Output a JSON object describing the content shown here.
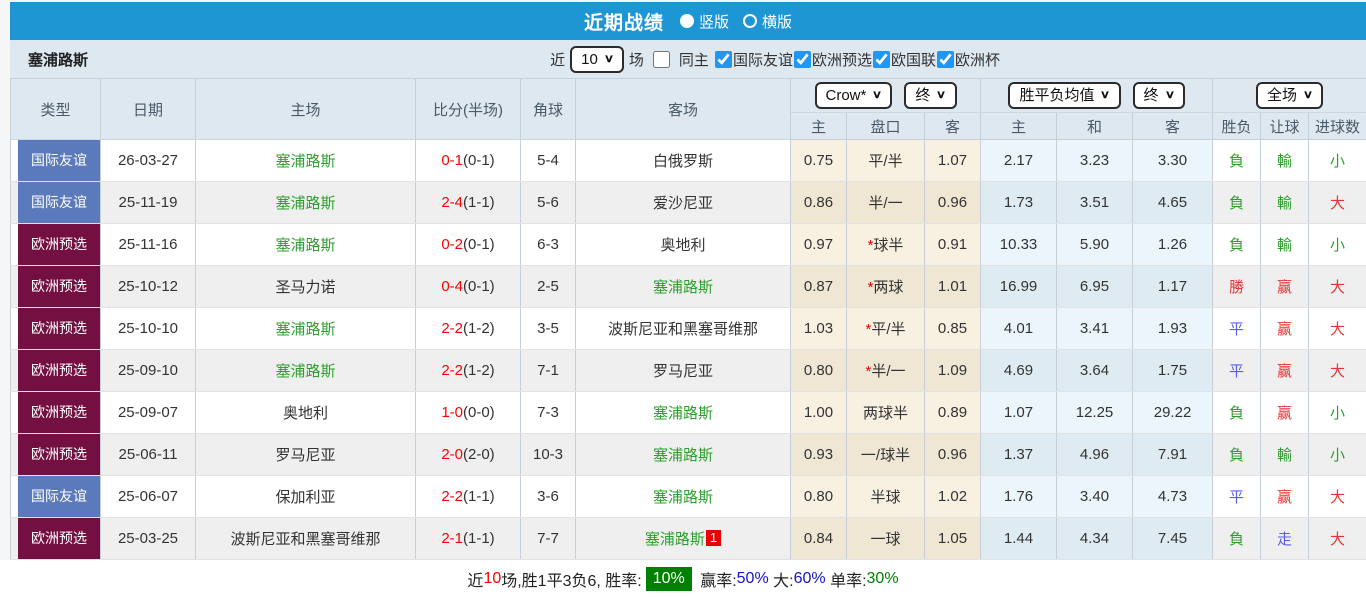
{
  "icons": {
    "chevron": "∨",
    "star": "*"
  },
  "colors": {
    "topbar_blue": "#1f96d4",
    "badge_friendly_blue": "#5b7abc",
    "badge_qualifier_maroon": "#730f41",
    "focus_team_green": "#2e9e2e",
    "score_red": "#ff0000",
    "result_green": "#2e9e2e",
    "result_red": "#e63434",
    "result_blue": "#5c5cf0"
  },
  "title_bar": {
    "title": "近期战绩",
    "radios": [
      {
        "label": "竖版",
        "selected": true
      },
      {
        "label": "横版",
        "selected": false
      }
    ]
  },
  "filter_bar": {
    "team": "塞浦路斯",
    "near_label": "近",
    "count_value": "10",
    "games_label": "场",
    "same_home": {
      "label": "同主",
      "checked": false
    },
    "leagues": [
      {
        "label": "国际友谊",
        "checked": true
      },
      {
        "label": "欧洲预选",
        "checked": true
      },
      {
        "label": "欧国联",
        "checked": true
      },
      {
        "label": "欧洲杯",
        "checked": true
      }
    ]
  },
  "table": {
    "main_headers": [
      "类型",
      "日期",
      "主场",
      "比分(半场)",
      "角球",
      "客场"
    ],
    "sub_headers": [
      "主",
      "盘口",
      "客",
      "主",
      "和",
      "客",
      "胜负",
      "让球",
      "进球数"
    ],
    "select_groups": {
      "bookmaker": {
        "label": "Crow*"
      },
      "bookmaker_time": {
        "label": "终"
      },
      "odds_type": {
        "label": "胜平负均值"
      },
      "odds_time": {
        "label": "终"
      },
      "scope": {
        "label": "全场"
      }
    },
    "rows": [
      {
        "type": "国际友谊",
        "type_color": "#5b7abc",
        "date": "26-03-27",
        "home": {
          "name": "塞浦路斯",
          "focus": true
        },
        "score": "0-1",
        "half": "(0-1)",
        "corner": "5-4",
        "away": {
          "name": "白俄罗斯",
          "focus": false,
          "card": ""
        },
        "odds": {
          "home": "0.75",
          "star": false,
          "handicap": "平/半",
          "away": "1.07"
        },
        "mean": {
          "home": "2.17",
          "draw": "3.23",
          "away": "3.30"
        },
        "result": {
          "text": "負",
          "color": "#2e9e2e"
        },
        "handicap_result": {
          "text": "輸",
          "color": "#2e9e2e"
        },
        "goals_result": {
          "text": "小",
          "color": "#2e9e2e"
        }
      },
      {
        "type": "国际友谊",
        "type_color": "#5b7abc",
        "date": "25-11-19",
        "home": {
          "name": "塞浦路斯",
          "focus": true
        },
        "score": "2-4",
        "half": "(1-1)",
        "corner": "5-6",
        "away": {
          "name": "爱沙尼亚",
          "focus": false,
          "card": ""
        },
        "odds": {
          "home": "0.86",
          "star": false,
          "handicap": "半/一",
          "away": "0.96"
        },
        "mean": {
          "home": "1.73",
          "draw": "3.51",
          "away": "4.65"
        },
        "result": {
          "text": "負",
          "color": "#2e9e2e"
        },
        "handicap_result": {
          "text": "輸",
          "color": "#2e9e2e"
        },
        "goals_result": {
          "text": "大",
          "color": "#e63434"
        }
      },
      {
        "type": "欧洲预选",
        "type_color": "#730f41",
        "date": "25-11-16",
        "home": {
          "name": "塞浦路斯",
          "focus": true
        },
        "score": "0-2",
        "half": "(0-1)",
        "corner": "6-3",
        "away": {
          "name": "奥地利",
          "focus": false,
          "card": ""
        },
        "odds": {
          "home": "0.97",
          "star": true,
          "handicap": "球半",
          "away": "0.91"
        },
        "mean": {
          "home": "10.33",
          "draw": "5.90",
          "away": "1.26"
        },
        "result": {
          "text": "負",
          "color": "#2e9e2e"
        },
        "handicap_result": {
          "text": "輸",
          "color": "#2e9e2e"
        },
        "goals_result": {
          "text": "小",
          "color": "#2e9e2e"
        }
      },
      {
        "type": "欧洲预选",
        "type_color": "#730f41",
        "date": "25-10-12",
        "home": {
          "name": "圣马力诺",
          "focus": false
        },
        "score": "0-4",
        "half": "(0-1)",
        "corner": "2-5",
        "away": {
          "name": "塞浦路斯",
          "focus": true,
          "card": ""
        },
        "odds": {
          "home": "0.87",
          "star": true,
          "handicap": "两球",
          "away": "1.01"
        },
        "mean": {
          "home": "16.99",
          "draw": "6.95",
          "away": "1.17"
        },
        "result": {
          "text": "勝",
          "color": "#e63434"
        },
        "handicap_result": {
          "text": "赢",
          "color": "#e63434"
        },
        "goals_result": {
          "text": "大",
          "color": "#e63434"
        }
      },
      {
        "type": "欧洲预选",
        "type_color": "#730f41",
        "date": "25-10-10",
        "home": {
          "name": "塞浦路斯",
          "focus": true
        },
        "score": "2-2",
        "half": "(1-2)",
        "corner": "3-5",
        "away": {
          "name": "波斯尼亚和黑塞哥维那",
          "focus": false,
          "card": ""
        },
        "odds": {
          "home": "1.03",
          "star": true,
          "handicap": "平/半",
          "away": "0.85"
        },
        "mean": {
          "home": "4.01",
          "draw": "3.41",
          "away": "1.93"
        },
        "result": {
          "text": "平",
          "color": "#5c5cf0"
        },
        "handicap_result": {
          "text": "赢",
          "color": "#e63434"
        },
        "goals_result": {
          "text": "大",
          "color": "#e63434"
        }
      },
      {
        "type": "欧洲预选",
        "type_color": "#730f41",
        "date": "25-09-10",
        "home": {
          "name": "塞浦路斯",
          "focus": true
        },
        "score": "2-2",
        "half": "(1-2)",
        "corner": "7-1",
        "away": {
          "name": "罗马尼亚",
          "focus": false,
          "card": ""
        },
        "odds": {
          "home": "0.80",
          "star": true,
          "handicap": "半/一",
          "away": "1.09"
        },
        "mean": {
          "home": "4.69",
          "draw": "3.64",
          "away": "1.75"
        },
        "result": {
          "text": "平",
          "color": "#5c5cf0"
        },
        "handicap_result": {
          "text": "赢",
          "color": "#e63434"
        },
        "goals_result": {
          "text": "大",
          "color": "#e63434"
        }
      },
      {
        "type": "欧洲预选",
        "type_color": "#730f41",
        "date": "25-09-07",
        "home": {
          "name": "奥地利",
          "focus": false
        },
        "score": "1-0",
        "half": "(0-0)",
        "corner": "7-3",
        "away": {
          "name": "塞浦路斯",
          "focus": true,
          "card": ""
        },
        "odds": {
          "home": "1.00",
          "star": false,
          "handicap": "两球半",
          "away": "0.89"
        },
        "mean": {
          "home": "1.07",
          "draw": "12.25",
          "away": "29.22"
        },
        "result": {
          "text": "負",
          "color": "#2e9e2e"
        },
        "handicap_result": {
          "text": "赢",
          "color": "#e63434"
        },
        "goals_result": {
          "text": "小",
          "color": "#2e9e2e"
        }
      },
      {
        "type": "欧洲预选",
        "type_color": "#730f41",
        "date": "25-06-11",
        "home": {
          "name": "罗马尼亚",
          "focus": false
        },
        "score": "2-0",
        "half": "(2-0)",
        "corner": "10-3",
        "away": {
          "name": "塞浦路斯",
          "focus": true,
          "card": ""
        },
        "odds": {
          "home": "0.93",
          "star": false,
          "handicap": "一/球半",
          "away": "0.96"
        },
        "mean": {
          "home": "1.37",
          "draw": "4.96",
          "away": "7.91"
        },
        "result": {
          "text": "負",
          "color": "#2e9e2e"
        },
        "handicap_result": {
          "text": "輸",
          "color": "#2e9e2e"
        },
        "goals_result": {
          "text": "小",
          "color": "#2e9e2e"
        }
      },
      {
        "type": "国际友谊",
        "type_color": "#5b7abc",
        "date": "25-06-07",
        "home": {
          "name": "保加利亚",
          "focus": false
        },
        "score": "2-2",
        "half": "(1-1)",
        "corner": "3-6",
        "away": {
          "name": "塞浦路斯",
          "focus": true,
          "card": ""
        },
        "odds": {
          "home": "0.80",
          "star": false,
          "handicap": "半球",
          "away": "1.02"
        },
        "mean": {
          "home": "1.76",
          "draw": "3.40",
          "away": "4.73"
        },
        "result": {
          "text": "平",
          "color": "#5c5cf0"
        },
        "handicap_result": {
          "text": "赢",
          "color": "#e63434"
        },
        "goals_result": {
          "text": "大",
          "color": "#e63434"
        }
      },
      {
        "type": "欧洲预选",
        "type_color": "#730f41",
        "date": "25-03-25",
        "home": {
          "name": "波斯尼亚和黑塞哥维那",
          "focus": false
        },
        "score": "2-1",
        "half": "(1-1)",
        "corner": "7-7",
        "away": {
          "name": "塞浦路斯",
          "focus": true,
          "card": "1"
        },
        "odds": {
          "home": "0.84",
          "star": false,
          "handicap": "一球",
          "away": "1.05"
        },
        "mean": {
          "home": "1.44",
          "draw": "4.34",
          "away": "7.45"
        },
        "result": {
          "text": "負",
          "color": "#2e9e2e"
        },
        "handicap_result": {
          "text": "走",
          "color": "#5c5cf0"
        },
        "goals_result": {
          "text": "大",
          "color": "#e63434"
        }
      }
    ]
  },
  "summary": {
    "parts": [
      {
        "text": "近"
      },
      {
        "text": "10",
        "color": "#ff0000"
      },
      {
        "text": "场,胜1平3负6, 胜率:"
      },
      {
        "text": "10%",
        "color": "#ffffff",
        "bg": "#008000"
      },
      {
        "text": " 赢率:"
      },
      {
        "text": "50%",
        "color": "#1414cc"
      },
      {
        "text": " 大:"
      },
      {
        "text": "60%",
        "color": "#1414cc"
      },
      {
        "text": " 单率:"
      },
      {
        "text": "30%",
        "color": "#008000"
      }
    ]
  }
}
